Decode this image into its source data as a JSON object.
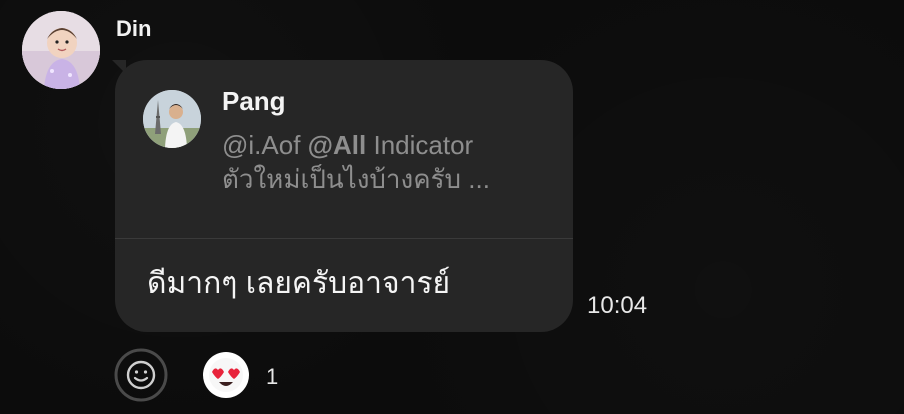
{
  "sender": {
    "name": "Din"
  },
  "reply": {
    "author": "Pang",
    "mention_user": "@i.Aof",
    "mention_all": "@All",
    "preview_rest": "Indicator",
    "preview_line2": "ตัวใหม่เป็นไงบ้างครับ ..."
  },
  "message": {
    "text": "ดีมากๆ เลยครับอาจารย์",
    "time": "10:04"
  },
  "reactions": {
    "emoji_icon": "heart-eyes-emoji-icon",
    "count": "1"
  },
  "colors": {
    "background": "#0c0c0c",
    "bubble": "#262626",
    "reply_text": "#8e8e8e",
    "primary_text": "#f5f5f5"
  }
}
